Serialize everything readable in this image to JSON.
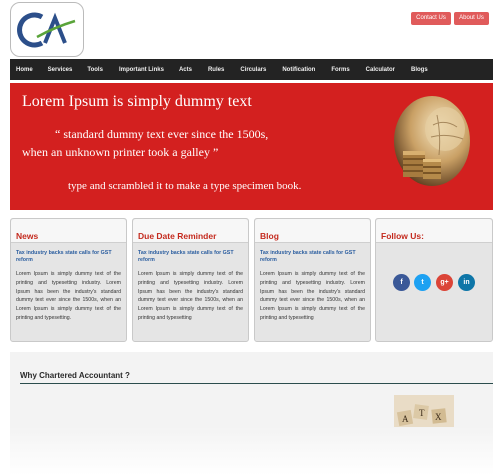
{
  "header": {
    "logo_alt": "CA logo",
    "contact_label": "Contact Us",
    "about_label": "About Us"
  },
  "nav": {
    "items": [
      "Home",
      "Services",
      "Tools",
      "Important Links",
      "Acts",
      "Rules",
      "Circulars",
      "Notification",
      "Forms",
      "Calculator",
      "Blogs"
    ]
  },
  "banner": {
    "line1": "Lorem Ipsum is simply dummy text",
    "line2": "“  standard dummy text ever since the 1500s,",
    "line3": "when an unknown printer took a galley  ”",
    "line4": "type and scrambled it to make a type specimen book.",
    "image_icon": "coins-globe-image"
  },
  "cards": [
    {
      "title": "News",
      "link": "Tax industry backs state calls for GST reform",
      "text": "Lorem Ipsum is simply dummy text of the printing and typesetting industry. Lorem Ipsum has been the industry's standard dummy text ever since the 1500s, when an Lorem Ipsum is simply dummy text of the printing and typesetting."
    },
    {
      "title": "Due Date Reminder",
      "link": "Tax industry backs state calls for GST reform",
      "text": "Lorem Ipsum is simply dummy text of the printing and typesetting industry. Lorem Ipsum has been the industry's standard dummy text ever since the 1500s, when an Lorem Ipsum is simply dummy text of the printing and typesetting"
    },
    {
      "title": "Blog",
      "link": "Tax industry backs state calls for GST reform",
      "text": "Lorem Ipsum is simply dummy text of the printing and typesetting industry. Lorem Ipsum has been the industry's standard dummy text ever since the 1500s, when an Lorem Ipsum is simply dummy text of the printing and typesetting"
    }
  ],
  "follow": {
    "title": "Follow Us:",
    "icons": [
      {
        "name": "facebook-icon",
        "glyph": "f"
      },
      {
        "name": "twitter-icon",
        "glyph": "t"
      },
      {
        "name": "google-plus-icon",
        "glyph": "g+"
      },
      {
        "name": "linkedin-icon",
        "glyph": "in"
      }
    ]
  },
  "why": {
    "title": "Why Chartered Accountant ?",
    "image_icon": "tax-letter-tiles-image"
  },
  "colors": {
    "banner_red": "#d3201f",
    "nav_dark": "#232323",
    "card_title": "#c42a1e",
    "link_blue": "#2a5d9f",
    "button_red": "#e05b5b"
  }
}
